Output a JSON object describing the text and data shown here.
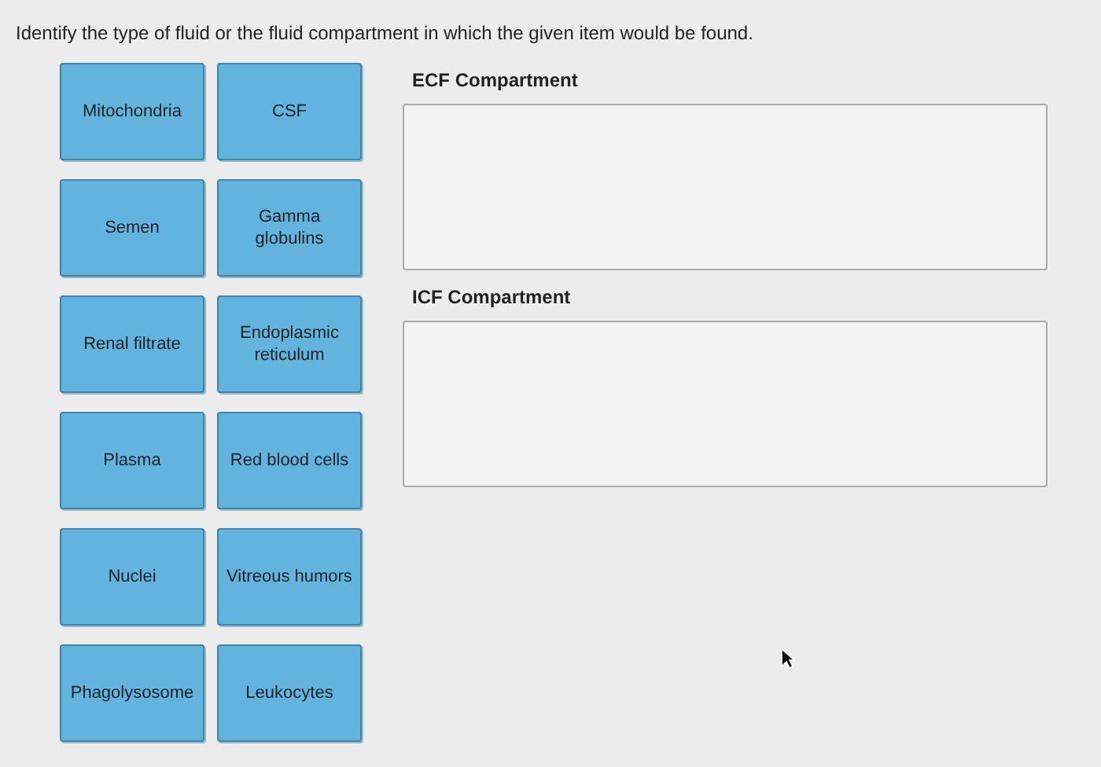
{
  "prompt": "Identify the type of fluid or the fluid compartment in which the given item would be found.",
  "item_rows": [
    {
      "items": [
        {
          "label": "Mitochondria"
        },
        {
          "label": "CSF"
        }
      ]
    },
    {
      "items": [
        {
          "label": "Semen"
        },
        {
          "label": "Gamma globulins"
        }
      ]
    },
    {
      "items": [
        {
          "label": "Renal filtrate"
        },
        {
          "label": "Endoplasmic reticulum"
        }
      ]
    },
    {
      "items": [
        {
          "label": "Plasma"
        },
        {
          "label": "Red blood cells"
        }
      ]
    },
    {
      "items": [
        {
          "label": "Nuclei"
        },
        {
          "label": "Vitreous humors"
        }
      ]
    },
    {
      "items": [
        {
          "label": "Phagolysosome"
        },
        {
          "label": "Leukocytes"
        }
      ]
    }
  ],
  "zones": [
    {
      "title": "ECF Compartment"
    },
    {
      "title": "ICF Compartment"
    }
  ]
}
